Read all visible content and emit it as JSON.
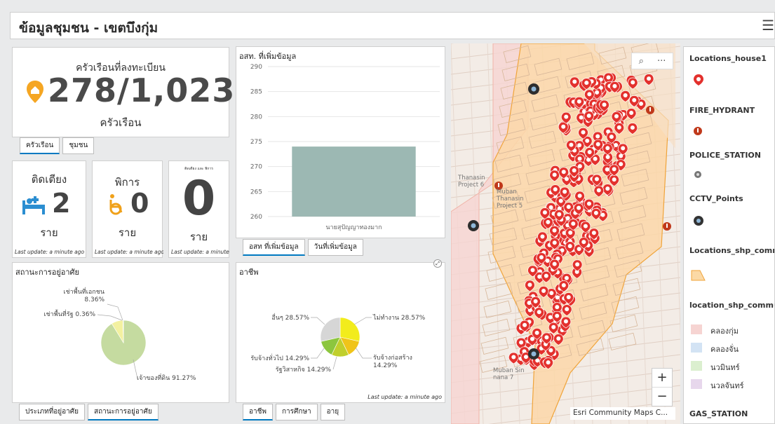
{
  "header": {
    "title": "ข้อมูลชุมชน - เขตบึงกุ่ม",
    "menu_icon": "hamburger-menu-icon"
  },
  "households": {
    "title": "ครัวเรือนที่ลงทะเบียน",
    "value": "278/1,023",
    "unit": "ครัวเรือน",
    "tabs": [
      "ครัวเรือน",
      "ชุมชน"
    ]
  },
  "bedridden": {
    "title": "ติดเตียง",
    "value": "2",
    "unit": "ราย",
    "updated": "Last update: a minute ago"
  },
  "disabled": {
    "title": "พิการ",
    "value": "0",
    "unit": "ราย",
    "updated": "Last update: a minute ago"
  },
  "both": {
    "title": "ติดเตียง และ พิการ",
    "value": "0",
    "unit": "ราย",
    "updated": "Last update: a minute ago"
  },
  "volunteers": {
    "title": "อสท. ที่เพิ่มข้อมูล",
    "tabs": [
      "อสท ที่เพิ่มข้อมูล",
      "วันที่เพิ่มข้อมูล"
    ]
  },
  "housing": {
    "title": "สถานะการอยู่อาศัย",
    "tabs": [
      "ประเภทที่อยู่อาศัย",
      "สถานะการอยู่อาศัย"
    ]
  },
  "occupation": {
    "title": "อาชีพ",
    "updated": "Last update: a minute ago",
    "tabs": [
      "อาชีพ",
      "การศึกษา",
      "อายุ"
    ]
  },
  "map": {
    "attribution": "Esri Community Maps C...",
    "zoom_in": "+",
    "zoom_out": "−",
    "search_icon": "search-icon",
    "more_icon": "more-icon",
    "labels": [
      "Thanasin Project 6",
      "Muban Thanasin Project 5",
      "Muban Sin nana 7"
    ]
  },
  "legend": {
    "layers": [
      {
        "name": "Locations_house1",
        "icon": "house-marker-icon"
      },
      {
        "name": "FIRE_HYDRANT",
        "icon": "fire-hydrant-icon"
      },
      {
        "name": "POLICE_STATION",
        "icon": "police-icon"
      },
      {
        "name": "CCTV_Points",
        "icon": "cctv-icon"
      },
      {
        "name": "Locations_shp_commu",
        "icon": "polygon-icon"
      },
      {
        "name": "location_shp_commu",
        "items": [
          {
            "label": "คลองกุ่ม",
            "color": "#f6d4d2"
          },
          {
            "label": "คลองจั่น",
            "color": "#d3e3f4"
          },
          {
            "label": "นวมินทร์",
            "color": "#dbefcf"
          },
          {
            "label": "นวลจันทร์",
            "color": "#e7d7ec"
          }
        ]
      },
      {
        "name": "GAS_STATION"
      }
    ]
  },
  "chart_data": [
    {
      "type": "bar",
      "title": "อสท. ที่เพิ่มข้อมูล",
      "categories": [
        "นายสุปัญญาทองมาก"
      ],
      "values": [
        274
      ],
      "ylim": [
        260,
        290
      ],
      "yticks": [
        260,
        265,
        270,
        275,
        280,
        285,
        290
      ],
      "color": "#9cb8b3",
      "grid": true
    },
    {
      "type": "pie",
      "title": "สถานะการอยู่อาศัย",
      "labels": [
        "เจ้าของที่ดิน 91.27%",
        "เช่าพื้นที่เอกชน 8.36%",
        "เช่าพื้นที่รัฐ 0.36%"
      ],
      "values": [
        91.27,
        8.36,
        0.36
      ],
      "colors": [
        "#c5dba0",
        "#f3f1a0",
        "#9fb0c5"
      ]
    },
    {
      "type": "pie",
      "title": "อาชีพ",
      "labels": [
        "ไม่ทำงาน 28.57%",
        "รับจ้างก่อสร้าง 14.29%",
        "รัฐวิสาหกิจ 14.29%",
        "รับจ้างทั่วไป 14.29%",
        "อื่นๆ 28.57%"
      ],
      "values": [
        28.57,
        14.29,
        14.29,
        14.29,
        28.57
      ],
      "colors": [
        "#f2ec1c",
        "#f0c419",
        "#c0cf2c",
        "#8cc63e",
        "#d6d6d6"
      ]
    }
  ]
}
